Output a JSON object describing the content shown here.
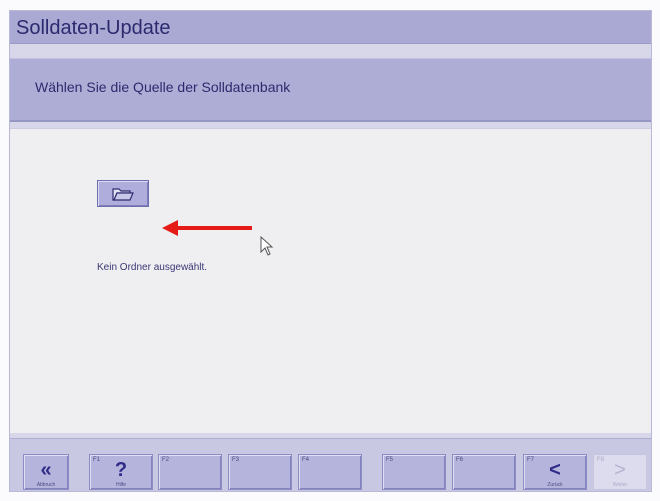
{
  "window": {
    "title": "Solldaten-Update",
    "subtitle": "Wählen Sie die Quelle der Solldatenbank"
  },
  "content": {
    "folder_button_icon": "folder-open-icon",
    "status": "Kein Ordner ausgewählt."
  },
  "toolbar": {
    "buttons": [
      {
        "key": "",
        "glyph": "«",
        "caption": "Abbruch",
        "icon": "double-chevron-left-icon",
        "enabled": true
      },
      {
        "key": "F1",
        "glyph": "?",
        "caption": "Hilfe",
        "icon": "help-icon",
        "enabled": true
      },
      {
        "key": "F2",
        "glyph": "",
        "caption": "",
        "icon": "",
        "enabled": true
      },
      {
        "key": "F3",
        "glyph": "",
        "caption": "",
        "icon": "",
        "enabled": true
      },
      {
        "key": "F4",
        "glyph": "",
        "caption": "",
        "icon": "",
        "enabled": true
      },
      {
        "key": "F5",
        "glyph": "",
        "caption": "",
        "icon": "",
        "enabled": true
      },
      {
        "key": "F6",
        "glyph": "",
        "caption": "",
        "icon": "",
        "enabled": true
      },
      {
        "key": "F7",
        "glyph": "<",
        "caption": "Zurück",
        "icon": "chevron-left-icon",
        "enabled": true
      },
      {
        "key": "F8",
        "glyph": ">",
        "caption": "Weiter",
        "icon": "chevron-right-icon",
        "enabled": false
      }
    ]
  },
  "colors": {
    "title_bar": "#aaa9d4",
    "content_bg": "#efeef0",
    "button_face": "#b5b4dc",
    "text_dark": "#2c2a6e",
    "annotation_arrow": "#e41b17"
  }
}
